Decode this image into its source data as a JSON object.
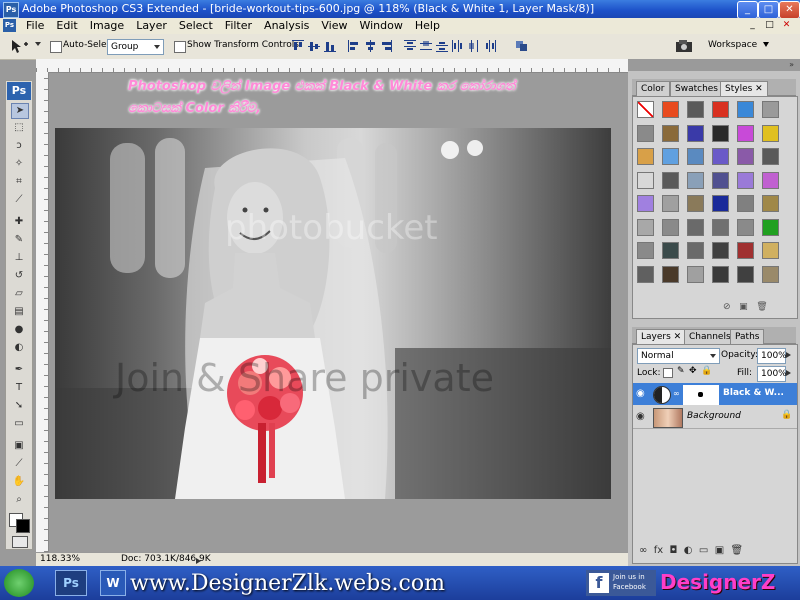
{
  "window": {
    "title": "Adobe Photoshop CS3 Extended - [bride-workout-tips-600.jpg @ 118% (Black & White 1, Layer Mask/8)]",
    "minimize": "_",
    "maximize": "□",
    "close": "✕"
  },
  "menu": {
    "ps_badge": "Ps",
    "items": [
      "File",
      "Edit",
      "Image",
      "Layer",
      "Select",
      "Filter",
      "Analysis",
      "View",
      "Window",
      "Help"
    ],
    "doc_min": "_",
    "doc_max": "□",
    "doc_close": "✕"
  },
  "options": {
    "auto_select_label": "Auto-Select:",
    "auto_select_value": "Group",
    "show_transform_label": "Show Transform Controls",
    "workspace_label": "Workspace"
  },
  "toolbox": {
    "logo": "Ps"
  },
  "canvas": {
    "overlay_line1": "Photoshop වලින් Image එකක් Black & White කර කෝරාගත්",
    "overlay_line2": "කොටසක් Color කිරීම,",
    "watermark_top": "photobucket",
    "watermark_bottom": "Join & Share private"
  },
  "status": {
    "zoom": "118.33%",
    "doc": "Doc: 703.1K/846.9K"
  },
  "styles_panel": {
    "tabs": [
      "Color",
      "Swatches",
      "Styles"
    ],
    "swatch_colors": [
      "#ffffff",
      "#e84a1e",
      "#5a5a5a",
      "#d83020",
      "#3a88d8",
      "#9a9a9a",
      "#8a8a8a",
      "#8a6a3a",
      "#3a3aa8",
      "#2a2a2a",
      "#c84ad8",
      "#e0c020",
      "#d8a048",
      "#60a0e0",
      "#5a8ac0",
      "#6a5ac8",
      "#8a5aa8",
      "#5a5a5a",
      "#d8d8d8",
      "#5a5a5a",
      "#8aa0b8",
      "#505090",
      "#9a7ad8",
      "#c060d0",
      "#a080e0",
      "#a0a0a0",
      "#8a7a5a",
      "#1a2a9a",
      "#808080",
      "#a08848",
      "#a8a8a8",
      "#8a8a8a",
      "#6a6a6a",
      "#707070",
      "#8a8a8a",
      "#20a020",
      "#8a8a8a",
      "#3a4a4a",
      "#6a6a6a",
      "#404040",
      "#a03030",
      "#d0b060",
      "#606060",
      "#4a3a2a",
      "#a0a0a0",
      "#3a3a3a",
      "#404040",
      "#9a8a6a"
    ]
  },
  "layers_panel": {
    "tabs": [
      "Layers",
      "Channels",
      "Paths"
    ],
    "blend_mode": "Normal",
    "opacity_label": "Opacity:",
    "opacity_value": "100%",
    "lock_label": "Lock:",
    "fill_label": "Fill:",
    "fill_value": "100%",
    "layers": [
      {
        "name": "Black & W...",
        "selected": true
      },
      {
        "name": "Background",
        "selected": false
      }
    ]
  },
  "taskbar": {
    "website": "www.DesignerZlk.webs.com",
    "facebook_line1": "Join us in",
    "facebook_line2": "Facebook",
    "brand": "DesignerZ",
    "ps_badge": "Ps",
    "word_badge": "W"
  },
  "colors": {
    "accent": "#1c50c8",
    "selected_layer": "#3d7fd8",
    "overlay_text": "#ff8ad8"
  }
}
